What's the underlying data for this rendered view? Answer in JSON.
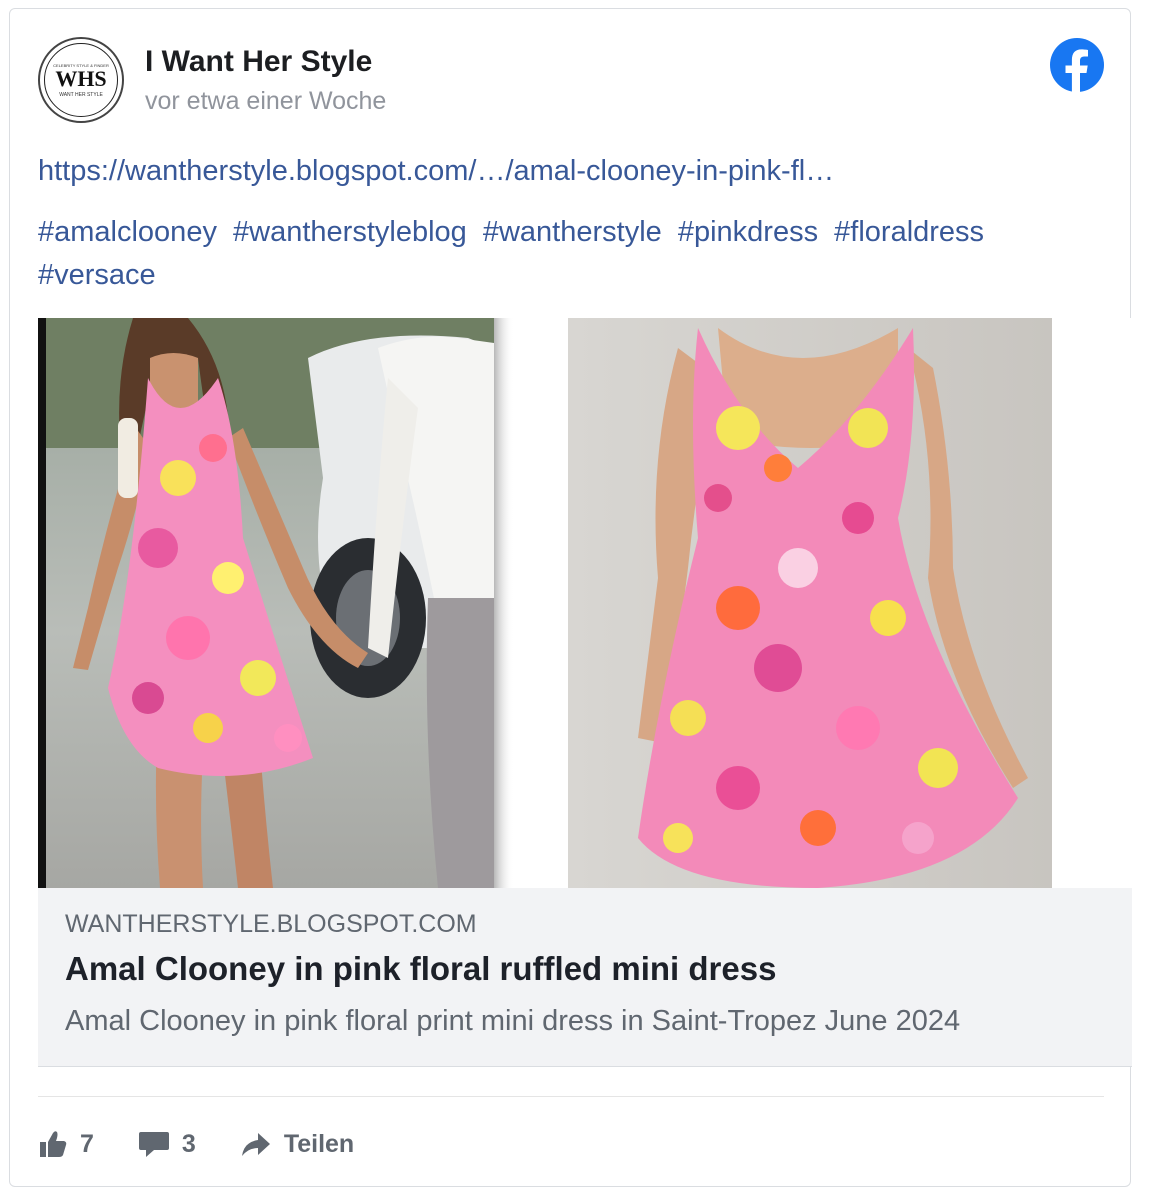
{
  "post": {
    "author": "I Want Her Style",
    "avatar_monogram": "WHS",
    "avatar_tagline": "CELEBRITY STYLE & FINDER",
    "avatar_subtitle": "WANT HER STYLE",
    "timestamp": "vor etwa einer Woche",
    "link": "https://wantherstyle.blogspot.com/…/amal-clooney-in-pink-fl…",
    "hashtags": [
      "#amalclooney",
      "#wantherstyleblog",
      "#wantherstyle",
      "#pinkdress",
      "#floraldress",
      "#versace"
    ]
  },
  "preview": {
    "domain": "WANTHERSTYLE.BLOGSPOT.COM",
    "title": "Amal Clooney in pink floral ruffled mini dress",
    "description": "Amal Clooney in pink floral print mini dress in Saint-Tropez June 2024"
  },
  "actions": {
    "likes": "7",
    "comments": "3",
    "share_label": "Teilen"
  },
  "colors": {
    "link": "#385898",
    "facebook_blue": "#1877f2",
    "dress_pink": "#f06aa8",
    "action_gray": "#606770"
  },
  "icons": [
    "facebook-logo-icon",
    "thumbs-up-icon",
    "comment-icon",
    "share-arrow-icon"
  ]
}
